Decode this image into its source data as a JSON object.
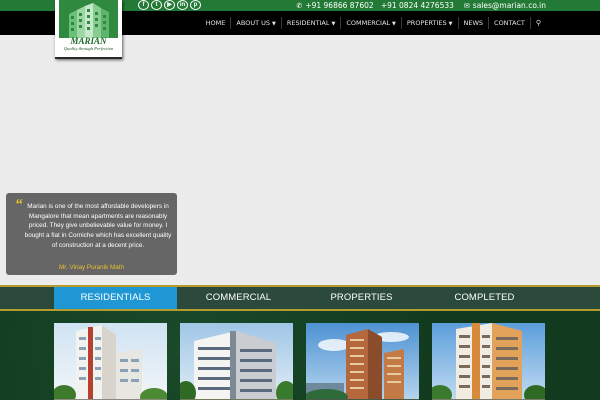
{
  "social": {
    "icons": [
      "facebook-icon",
      "twitter-icon",
      "youtube-icon",
      "linkedin-icon",
      "pinterest-icon"
    ],
    "glyphs": [
      "f",
      "t",
      "▶",
      "in",
      "p"
    ]
  },
  "contact": {
    "phone1": "+91 96866 87602",
    "phone2": "+91 0824 4276533",
    "email": "sales@marian.co.in"
  },
  "nav": {
    "items": [
      {
        "label": "HOME",
        "dropdown": false
      },
      {
        "label": "ABOUT US",
        "dropdown": true
      },
      {
        "label": "RESIDENTIAL",
        "dropdown": true
      },
      {
        "label": "COMMERCIAL",
        "dropdown": true
      },
      {
        "label": "PROPERTIES",
        "dropdown": true
      },
      {
        "label": "NEWS",
        "dropdown": false
      },
      {
        "label": "CONTACT",
        "dropdown": false
      }
    ]
  },
  "logo": {
    "brand": "MARIAN",
    "tagline": "Quality through Perfection"
  },
  "testimonial": {
    "text": "Marian is one of the most affordable developers in Mangalore that mean apartments are reasonably priced. They give unbelievable value for money. I bought a flat in Corniche which has excellent quality of construction at a decent price.",
    "author": "Mr. Vinay Puranik Math"
  },
  "tabs": {
    "items": [
      "RESIDENTIALS",
      "COMMERCIAL",
      "PROPERTIES",
      "COMPLETED"
    ],
    "active_index": 0
  },
  "colors": {
    "topbar": "#237a36",
    "navbar": "#000000",
    "tab_active": "#1f97d4",
    "tab_band": "#2c4a3c",
    "accent_gold": "#b69b2e",
    "projects_bg": "#143c21"
  }
}
